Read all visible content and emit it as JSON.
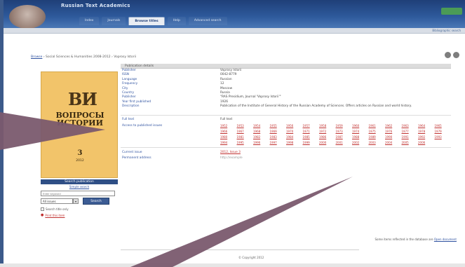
{
  "header": {
    "site_title": "Russian Text Academics",
    "tabs": [
      "Index",
      "Journals",
      "Browse titles",
      "Help",
      "Advanced search"
    ],
    "active_tab_index": 2,
    "right_link": "Bibliographic search"
  },
  "breadcrumb": {
    "root": "Browse",
    "trail": "› Social Sciences & Humanities 2008-2012 › Voprosy Istorii"
  },
  "cover": {
    "logo": "ВИ",
    "title": "ВОПРОСЫ ИСТОРИИ",
    "issue": "3",
    "year": "2012"
  },
  "left_panel": {
    "title": "Search publication",
    "subtitle": "Simple search",
    "search_placeholder": "Enter keyword",
    "select_value": "All issues",
    "search_button": "Search",
    "option_checkbox": "Search title only",
    "option_link": "Print this item"
  },
  "details": {
    "header": "Publication details",
    "rows": [
      {
        "label": "Publisher",
        "value": "Voprosy Istorii"
      },
      {
        "label": "ISSN",
        "value": "0042-8779"
      },
      {
        "label": "Language",
        "value": "Russian"
      },
      {
        "label": "Frequency",
        "value": "12"
      },
      {
        "label": "City",
        "value": "Moscow"
      },
      {
        "label": "Country",
        "value": "Russia"
      },
      {
        "label": "Publisher",
        "value": "\"RAS Presidium, Journal 'Voprosy Istorii'\""
      },
      {
        "label": "Year first published",
        "value": "1926"
      }
    ],
    "description_label": "Description",
    "description": "Publication of the Institute of General History of the Russian Academy of Sciences. Offers articles on Russian and world history.",
    "coverage_label": "Full text",
    "coverage_value": "Full text",
    "years_label": "Access to published issues",
    "years": [
      "1952",
      "1953",
      "1954",
      "1955",
      "1956",
      "1957",
      "1958",
      "1959",
      "1960",
      "1961",
      "1962",
      "1963",
      "1964",
      "1965",
      "1966",
      "1967",
      "1968",
      "1969",
      "1970",
      "1971",
      "1972",
      "1973",
      "1974",
      "1975",
      "1976",
      "1977",
      "1978",
      "1979",
      "1980",
      "1981",
      "1982",
      "1983",
      "1984",
      "1985",
      "1986",
      "1987",
      "1988",
      "1989",
      "1990",
      "1991",
      "1992",
      "1993",
      "1994",
      "1995",
      "1996",
      "1997",
      "1998",
      "1999",
      "2000",
      "2001",
      "2002",
      "2003",
      "2004",
      "2005",
      "2006"
    ],
    "other_label": "Current issue",
    "other_value": "2012, Issue 3",
    "permanent_label": "Permanent address",
    "permanent_value": "http://example"
  },
  "notice": {
    "text": "Some items reflected in the database are",
    "link": "Open document"
  },
  "copyright": "© Copyright 2012",
  "colors": {
    "header_dark": "#1f3f78",
    "accent_link": "#2f52a0",
    "year_link": "#c0302f",
    "cover_yellow": "#f2c46a",
    "arrow_plum": "#7a5a6e"
  }
}
